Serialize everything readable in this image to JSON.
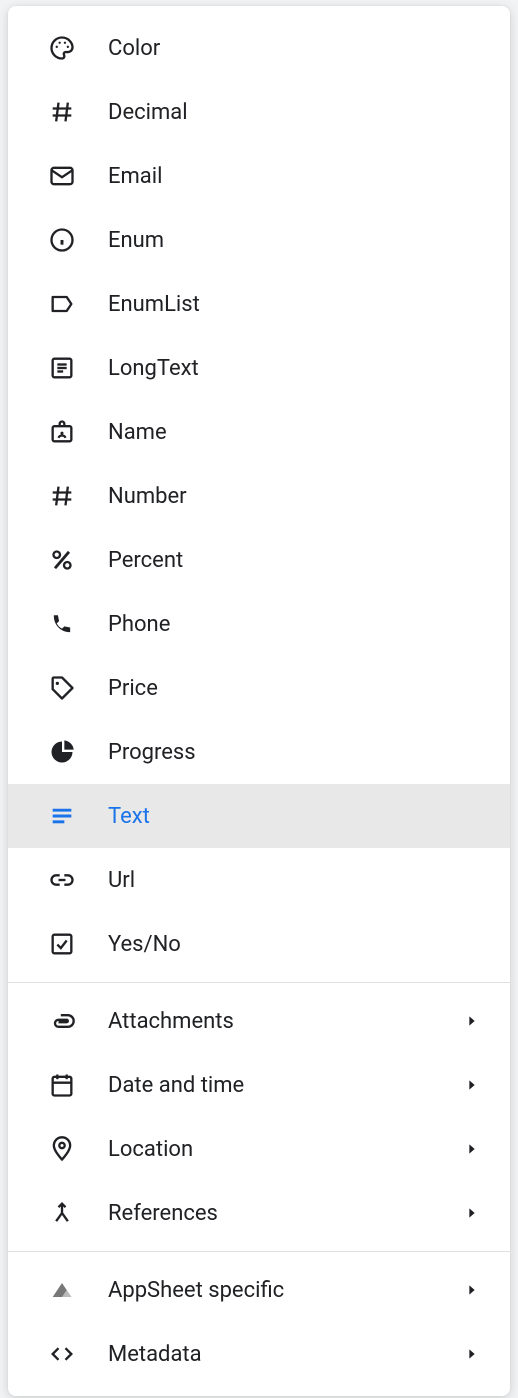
{
  "menu": {
    "groups": [
      {
        "id": "basic",
        "items": [
          {
            "id": "color",
            "label": "Color",
            "icon": "palette-icon"
          },
          {
            "id": "decimal",
            "label": "Decimal",
            "icon": "hash-icon"
          },
          {
            "id": "email",
            "label": "Email",
            "icon": "envelope-icon"
          },
          {
            "id": "enum",
            "label": "Enum",
            "icon": "clock-icon"
          },
          {
            "id": "enumlist",
            "label": "EnumList",
            "icon": "label-icon"
          },
          {
            "id": "longtext",
            "label": "LongText",
            "icon": "paragraph-icon"
          },
          {
            "id": "name",
            "label": "Name",
            "icon": "badge-icon"
          },
          {
            "id": "number",
            "label": "Number",
            "icon": "hash-icon"
          },
          {
            "id": "percent",
            "label": "Percent",
            "icon": "percent-icon"
          },
          {
            "id": "phone",
            "label": "Phone",
            "icon": "phone-icon"
          },
          {
            "id": "price",
            "label": "Price",
            "icon": "tag-icon"
          },
          {
            "id": "progress",
            "label": "Progress",
            "icon": "pie-icon"
          },
          {
            "id": "text",
            "label": "Text",
            "icon": "lines-icon",
            "selected": true
          },
          {
            "id": "url",
            "label": "Url",
            "icon": "link-icon"
          },
          {
            "id": "yesno",
            "label": "Yes/No",
            "icon": "checkbox-icon"
          }
        ]
      },
      {
        "id": "categories1",
        "items": [
          {
            "id": "attachments",
            "label": "Attachments",
            "icon": "attachment-icon",
            "submenu": true
          },
          {
            "id": "datetime",
            "label": "Date and time",
            "icon": "calendar-icon",
            "submenu": true
          },
          {
            "id": "location",
            "label": "Location",
            "icon": "pin-icon",
            "submenu": true
          },
          {
            "id": "references",
            "label": "References",
            "icon": "merge-icon",
            "submenu": true
          }
        ]
      },
      {
        "id": "categories2",
        "items": [
          {
            "id": "appsheet",
            "label": "AppSheet specific",
            "icon": "appsheet-icon",
            "submenu": true
          },
          {
            "id": "metadata",
            "label": "Metadata",
            "icon": "code-icon",
            "submenu": true
          }
        ]
      }
    ]
  },
  "colors": {
    "selectedText": "#1a73e8",
    "selectedBg": "#e8e8e8",
    "text": "#202124",
    "divider": "#e0e0e0"
  }
}
